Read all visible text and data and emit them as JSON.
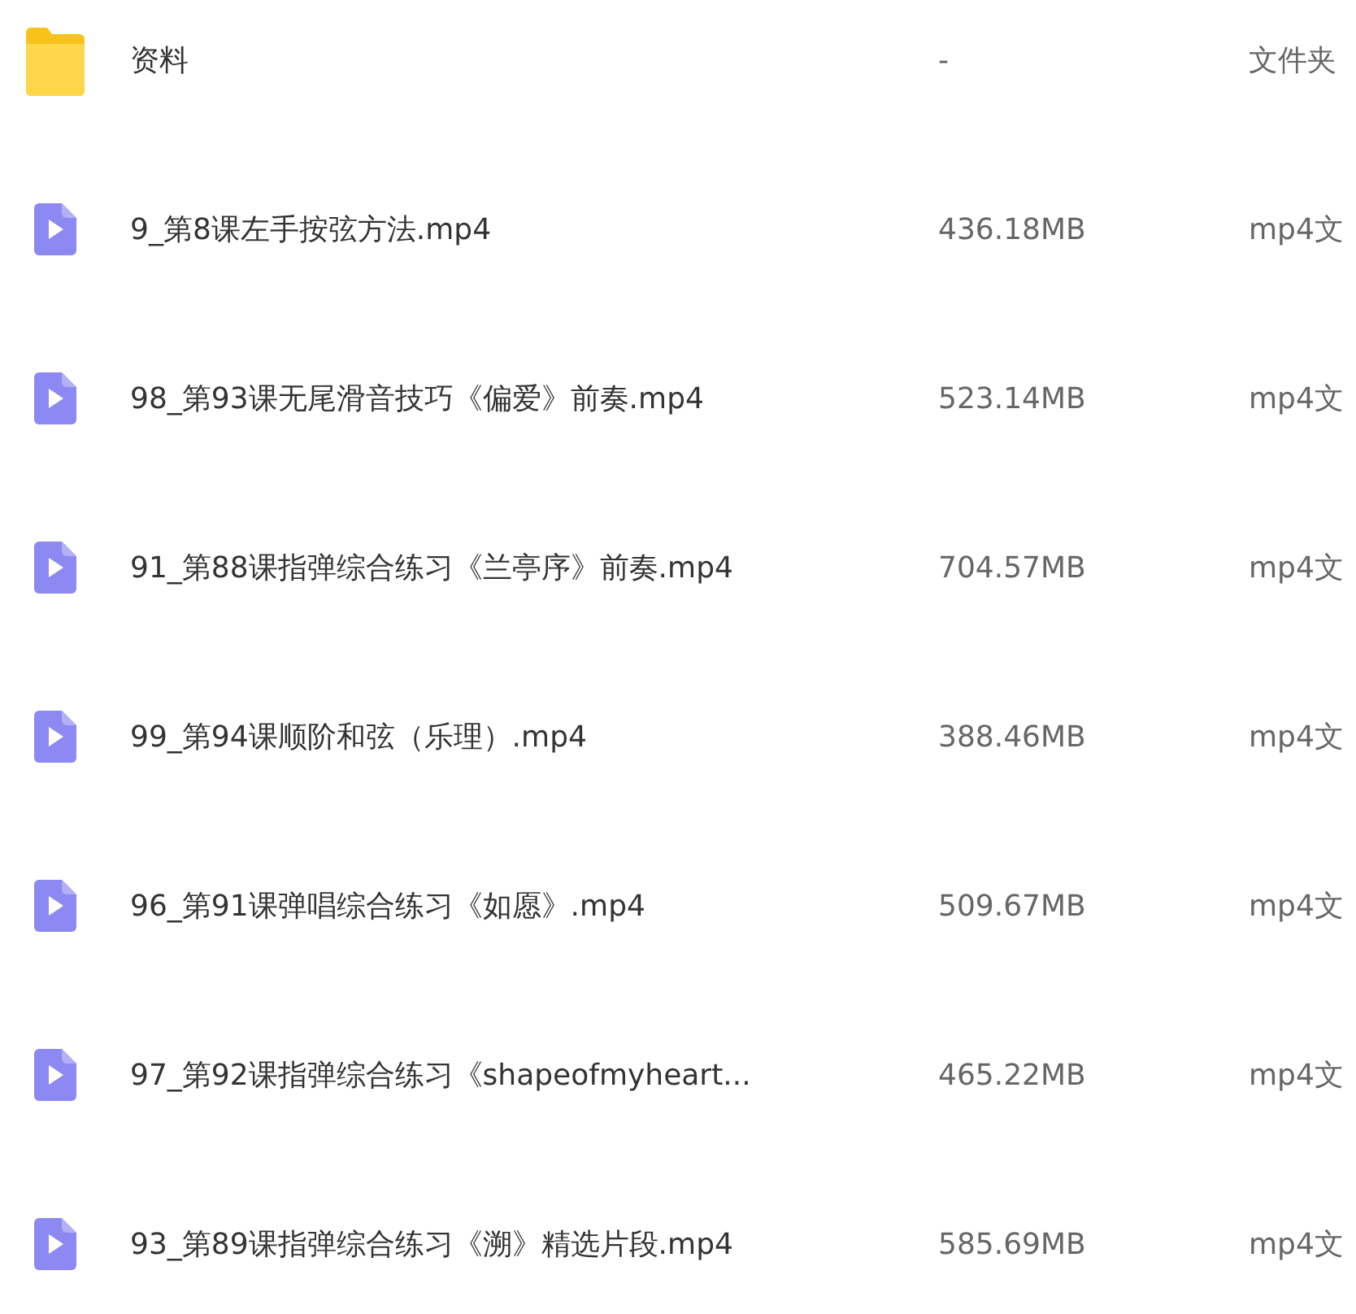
{
  "files": [
    {
      "kind": "folder",
      "name": "资料",
      "size": "-",
      "type": "文件夹"
    },
    {
      "kind": "video",
      "name": "9_第8课左手按弦方法.mp4",
      "size": "436.18MB",
      "type": "mp4文"
    },
    {
      "kind": "video",
      "name": "98_第93课无尾滑音技巧《偏爱》前奏.mp4",
      "size": "523.14MB",
      "type": "mp4文"
    },
    {
      "kind": "video",
      "name": "91_第88课指弹综合练习《兰亭序》前奏.mp4",
      "size": "704.57MB",
      "type": "mp4文"
    },
    {
      "kind": "video",
      "name": "99_第94课顺阶和弦（乐理）.mp4",
      "size": "388.46MB",
      "type": "mp4文"
    },
    {
      "kind": "video",
      "name": "96_第91课弹唱综合练习《如愿》.mp4",
      "size": "509.67MB",
      "type": "mp4文"
    },
    {
      "kind": "video",
      "name": "97_第92课指弹综合练习《shapeofmyheart...",
      "size": "465.22MB",
      "type": "mp4文"
    },
    {
      "kind": "video",
      "name": "93_第89课指弹综合练习《溯》精选片段.mp4",
      "size": "585.69MB",
      "type": "mp4文"
    }
  ]
}
